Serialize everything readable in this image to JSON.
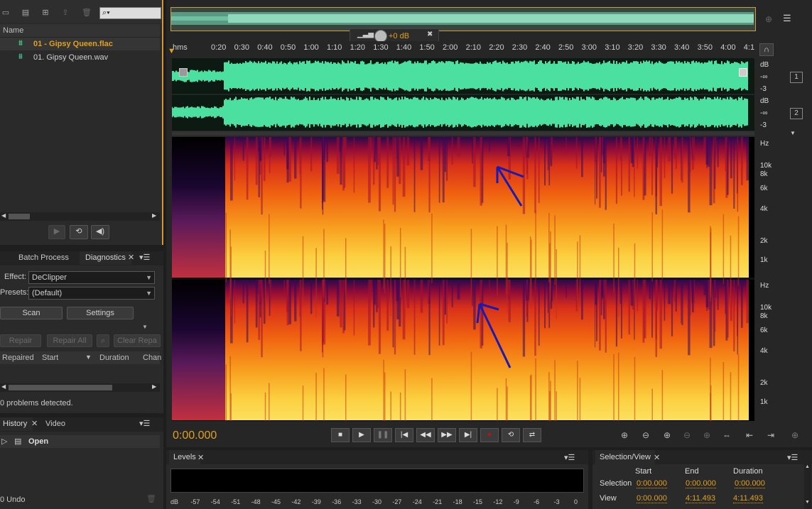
{
  "files": {
    "column_header": "Name",
    "items": [
      {
        "label": "01 - Gipsy Queen.flac",
        "active": true
      },
      {
        "label": "01. Gipsy Queen.wav",
        "active": false
      }
    ]
  },
  "diagnostics": {
    "tabs": [
      "Batch Process",
      "Diagnostics"
    ],
    "effect_label": "Effect:",
    "effect_value": "DeClipper",
    "presets_label": "Presets:",
    "presets_value": "(Default)",
    "scan_label": "Scan",
    "settings_label": "Settings",
    "repair_label": "Repair",
    "repair_all_label": "Repair All",
    "clear_repaired_label": "Clear Repa",
    "columns": [
      "Repaired",
      "Start",
      "Duration",
      "Chan"
    ],
    "status": "0 problems detected."
  },
  "history": {
    "tabs": [
      "History",
      "Video"
    ],
    "open_label": "Open",
    "undo_label": "0 Undo"
  },
  "editor": {
    "gain_value": "+0 dB",
    "ruler_unit": "hms",
    "ruler_ticks": [
      "0:20",
      "0:30",
      "0:40",
      "0:50",
      "1:00",
      "1:10",
      "1:20",
      "1:30",
      "1:40",
      "1:50",
      "2:00",
      "2:10",
      "2:20",
      "2:30",
      "2:40",
      "2:50",
      "3:00",
      "3:10",
      "3:20",
      "3:30",
      "3:40",
      "3:50",
      "4:00",
      "4:1"
    ],
    "channel_1": "1",
    "channel_2": "2",
    "db_label": "dB",
    "db_inf": "-∞",
    "db_minus3": "-3",
    "hz_labels": [
      "Hz",
      "10k",
      "8k",
      "6k",
      "4k",
      "2k",
      "1k"
    ],
    "time_display": "0:00.000"
  },
  "levels": {
    "title": "Levels",
    "ticks": [
      "dB",
      "-57",
      "-54",
      "-51",
      "-48",
      "-45",
      "-42",
      "-39",
      "-36",
      "-33",
      "-30",
      "-27",
      "-24",
      "-21",
      "-18",
      "-15",
      "-12",
      "-9",
      "-6",
      "-3",
      "0"
    ]
  },
  "selection": {
    "title": "Selection/View",
    "col_start": "Start",
    "col_end": "End",
    "col_duration": "Duration",
    "row_selection": "Selection",
    "row_view": "View",
    "sel_start": "0:00.000",
    "sel_end": "0:00.000",
    "sel_duration": "0:00.000",
    "view_start": "0:00.000",
    "view_end": "4:11.493",
    "view_duration": "4:11.493"
  },
  "colors": {
    "waveform": "#4be0a0",
    "accent": "#e0a020",
    "annotation": "#1a1ab0"
  }
}
